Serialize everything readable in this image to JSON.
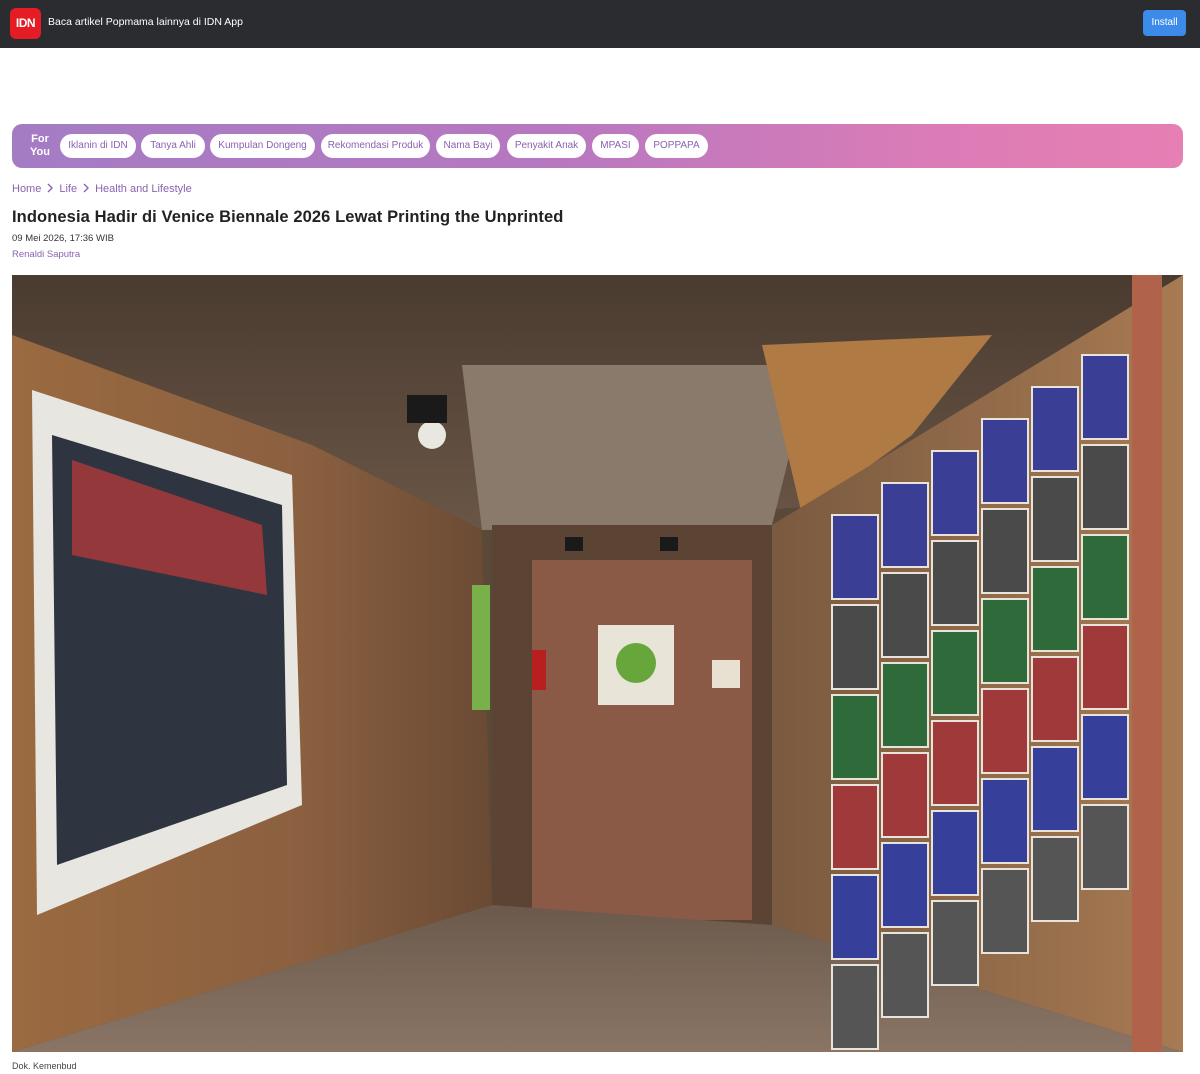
{
  "app_banner": {
    "logo_text": "IDN",
    "message": "Baca artikel Popmama lainnya di IDN App",
    "install_label": "Install"
  },
  "for_you": {
    "label": "For You",
    "chips": [
      "Iklanin di IDN",
      "Tanya Ahli",
      "Kumpulan Dongeng",
      "Rekomendasi Produk",
      "Nama Bayi",
      "Penyakit Anak",
      "MPASI",
      "POPPAPA"
    ]
  },
  "breadcrumb": [
    "Home",
    "Life",
    "Health and Lifestyle"
  ],
  "article": {
    "title": "Indonesia Hadir di Venice Biennale 2026 Lewat Printing the Unprinted",
    "date": "09 Mei 2026, 17:36 WIB",
    "author": "Renaldi Saputra",
    "image_caption": "Dok. Kemenbud"
  },
  "colors": {
    "banner_bg": "#2b2c30",
    "logo_red": "#e51c23",
    "install_blue": "#3d8be8",
    "accent_purple": "#8a62b0",
    "gradient_start": "#a47cc4",
    "gradient_end": "#e67fb3"
  }
}
